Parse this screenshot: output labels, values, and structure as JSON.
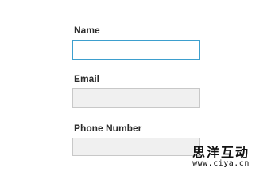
{
  "form": {
    "fields": [
      {
        "label": "Name",
        "value": "",
        "placeholder": "",
        "state": "focused"
      },
      {
        "label": "Email",
        "value": "",
        "placeholder": "",
        "state": "default"
      },
      {
        "label": "Phone Number",
        "value": "",
        "placeholder": "",
        "state": "default"
      }
    ]
  },
  "watermark": {
    "title": "思洋互动",
    "url": "www.ciya.cn"
  },
  "colors": {
    "focus_border": "#3d9fce",
    "input_border": "#c8c8c8",
    "input_background": "#f0f0f0",
    "label_text": "#2b2b2b"
  }
}
